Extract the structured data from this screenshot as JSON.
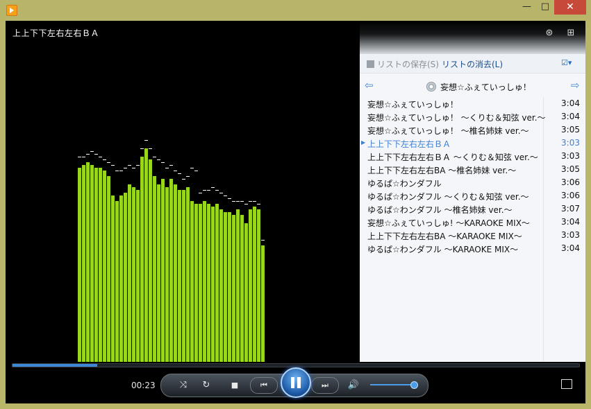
{
  "window": {
    "app_icon": "media-player-icon",
    "min_label": "—",
    "max_label": "□",
    "close_label": "✕"
  },
  "now_playing": {
    "title": "上上下下左右左右ＢＡ"
  },
  "visualizer": {
    "bar_color": "#9ad61b",
    "peak_color": "#ffffff",
    "levels": [
      0.7,
      0.71,
      0.72,
      0.71,
      0.7,
      0.7,
      0.69,
      0.67,
      0.6,
      0.58,
      0.6,
      0.61,
      0.64,
      0.63,
      0.62,
      0.74,
      0.77,
      0.73,
      0.67,
      0.64,
      0.66,
      0.63,
      0.66,
      0.64,
      0.62,
      0.62,
      0.63,
      0.58,
      0.57,
      0.57,
      0.58,
      0.57,
      0.56,
      0.57,
      0.55,
      0.54,
      0.54,
      0.53,
      0.55,
      0.53,
      0.5,
      0.55,
      0.56,
      0.55,
      0.42
    ],
    "peaks": [
      0.74,
      0.74,
      0.75,
      0.76,
      0.75,
      0.74,
      0.73,
      0.72,
      0.71,
      0.69,
      0.69,
      0.7,
      0.71,
      0.7,
      0.71,
      0.77,
      0.8,
      0.77,
      0.74,
      0.73,
      0.72,
      0.7,
      0.71,
      0.69,
      0.68,
      0.66,
      0.67,
      0.7,
      0.69,
      0.61,
      0.62,
      0.62,
      0.63,
      0.62,
      0.61,
      0.6,
      0.59,
      0.58,
      0.58,
      0.58,
      0.57,
      0.58,
      0.58,
      0.57,
      0.44
    ]
  },
  "playlist": {
    "top_icons": [
      "disc-refresh-icon",
      "switch-view-icon"
    ],
    "save_label": "リストの保存(S)",
    "clear_label": "リストの消去(L)",
    "options_icon": "list-options-icon",
    "name": "妄想☆ふぇていっしゅ！",
    "tracks": [
      {
        "title": "妄想☆ふぇていっしゅ！",
        "duration": "3:04"
      },
      {
        "title": "妄想☆ふぇていっしゅ！ ～くりむ＆知弦 ver.～",
        "duration": "3:04"
      },
      {
        "title": "妄想☆ふぇていっしゅ！ ～椎名姉妹 ver.～",
        "duration": "3:05"
      },
      {
        "title": "上上下下左右左右ＢＡ",
        "duration": "3:03"
      },
      {
        "title": "上上下下左右左右ＢＡ ～くりむ＆知弦 ver.～",
        "duration": "3:03"
      },
      {
        "title": "上上下下左右左右BA ～椎名姉妹 ver.～",
        "duration": "3:05"
      },
      {
        "title": "ゆるぱ☆わンダフル",
        "duration": "3:06"
      },
      {
        "title": "ゆるぱ☆わンダフル ～くりむ＆知弦 ver.～",
        "duration": "3:06"
      },
      {
        "title": "ゆるぱ☆わンダフル ～椎名姉妹 ver.～",
        "duration": "3:07"
      },
      {
        "title": "妄想☆ふぇていっしゅ! ～KARAOKE MIX～",
        "duration": "3:04"
      },
      {
        "title": "上上下下左右左右BA ～KARAOKE MIX～",
        "duration": "3:03"
      },
      {
        "title": "ゆるぱ☆わンダフル ～KARAOKE MIX～",
        "duration": "3:04"
      }
    ],
    "current_index": 3
  },
  "controls": {
    "elapsed": "00:23",
    "progress": 0.15,
    "volume": 0.95,
    "accent": "#3e86d6"
  }
}
